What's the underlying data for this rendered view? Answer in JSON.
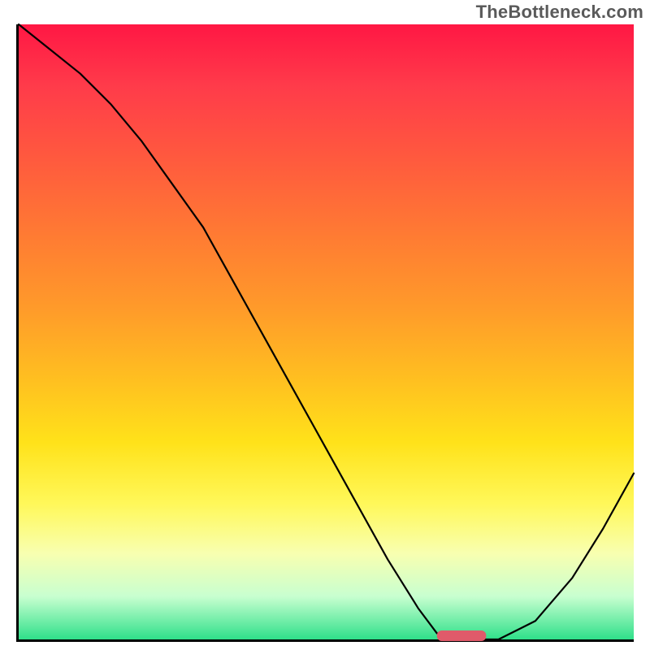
{
  "watermark": "TheBottleneck.com",
  "colors": {
    "axis": "#000000",
    "curve": "#000000",
    "marker": "#e05a6a",
    "gradient_top": "#ff1744",
    "gradient_bottom": "#2fe08a"
  },
  "chart_data": {
    "type": "line",
    "title": "",
    "xlabel": "",
    "ylabel": "",
    "xlim": [
      0,
      100
    ],
    "ylim": [
      0,
      100
    ],
    "x": [
      0,
      5,
      10,
      15,
      20,
      25,
      30,
      35,
      40,
      45,
      50,
      55,
      60,
      65,
      68,
      72,
      78,
      84,
      90,
      95,
      100
    ],
    "values": [
      100,
      96,
      92,
      87,
      81,
      74,
      67,
      58,
      49,
      40,
      31,
      22,
      13,
      5,
      1,
      0,
      0,
      3,
      10,
      18,
      27
    ],
    "optimal_marker": {
      "x_start": 68,
      "x_end": 76,
      "y": 0
    },
    "note": "Axes are unlabeled in the source image; numeric values are estimated from pixel positions on a normalized 0–100 scale. Curve shows bottleneck-style mismatch dropping to ~0 near x≈72 then rising again."
  }
}
